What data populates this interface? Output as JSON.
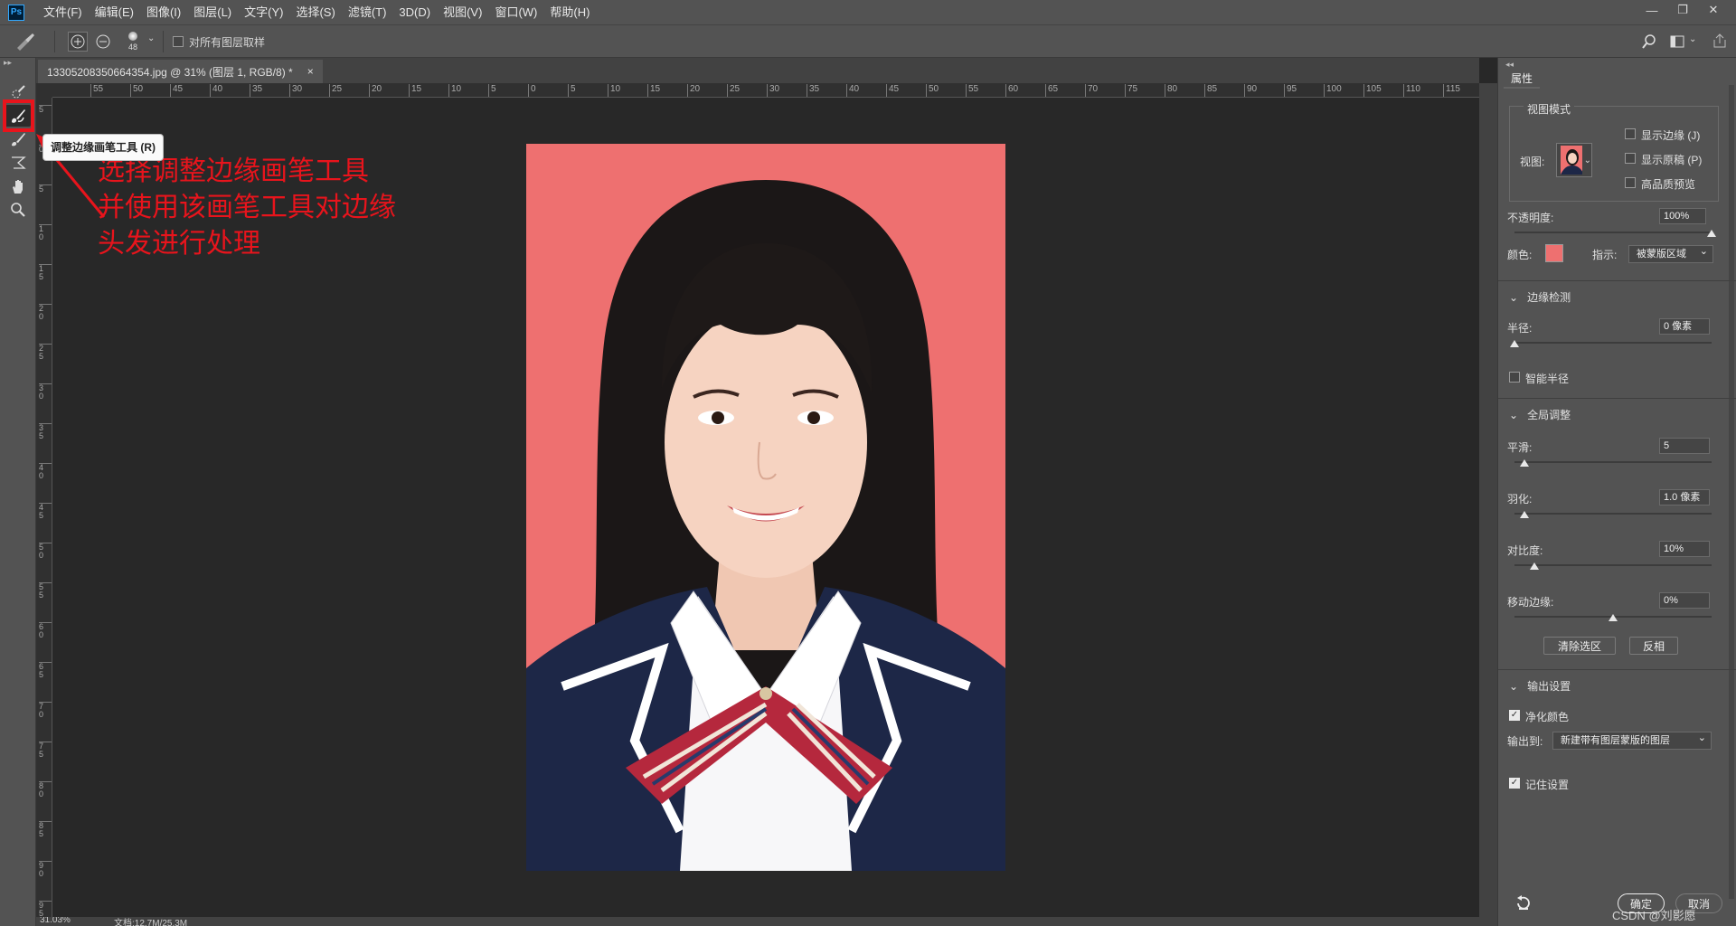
{
  "app": {
    "logo": "Ps"
  },
  "menu": [
    "文件(F)",
    "编辑(E)",
    "图像(I)",
    "图层(L)",
    "文字(Y)",
    "选择(S)",
    "滤镜(T)",
    "3D(D)",
    "视图(V)",
    "窗口(W)",
    "帮助(H)"
  ],
  "options": {
    "brush_size": "48",
    "sample_all_layers": "对所有图层取样"
  },
  "document": {
    "tab_title": "13305208350664354.jpg @ 31% (图层 1, RGB/8) *",
    "close": "×"
  },
  "ruler": {
    "h_ticks": [
      "55",
      "50",
      "45",
      "40",
      "35",
      "30",
      "25",
      "20",
      "15",
      "10",
      "5",
      "0",
      "5",
      "10",
      "15",
      "20",
      "25",
      "30",
      "35",
      "40",
      "45",
      "50",
      "55",
      "60",
      "65",
      "70",
      "75",
      "80",
      "85",
      "90",
      "95",
      "100",
      "105",
      "110",
      "115"
    ],
    "v_ticks": [
      "5",
      "0",
      "5",
      "1\n0",
      "1\n5",
      "2\n0",
      "2\n5",
      "3\n0",
      "3\n5",
      "4\n0",
      "4\n5",
      "5\n0",
      "5\n5",
      "6\n0",
      "6\n5",
      "7\n0",
      "7\n5",
      "8\n0",
      "8\n5",
      "9\n0",
      "9\n5"
    ]
  },
  "tooltip": {
    "text": "调整边缘画笔工具 (R)"
  },
  "annotation": {
    "lines": [
      "选择调整边缘画笔工具",
      "并使用该画笔工具对边缘",
      "头发进行处理"
    ],
    "color": "#e8141c"
  },
  "status": {
    "zoom": "31.03%",
    "doc": "文档:12.7M/25.3M"
  },
  "panel": {
    "tab": "属性",
    "view_mode": {
      "title": "视图模式",
      "view_label": "视图:",
      "show_edge": "显示边缘 (J)",
      "show_original": "显示原稿 (P)",
      "hq_preview": "高品质预览"
    },
    "opacity": {
      "label": "不透明度:",
      "value": "100%",
      "level": 1.0
    },
    "color": {
      "label": "颜色:",
      "swatch": "#ee7070",
      "indicate_label": "指示:",
      "indicate_value": "被蒙版区域"
    },
    "edge_detection": {
      "title": "边缘检测",
      "radius_label": "半径:",
      "radius_value": "0 像素",
      "radius_level": 0.0,
      "smart_radius": "智能半径"
    },
    "global": {
      "title": "全局调整",
      "smooth_label": "平滑:",
      "smooth_value": "5",
      "smooth_level": 0.05,
      "feather_label": "羽化:",
      "feather_value": "1.0 像素",
      "feather_level": 0.05,
      "contrast_label": "对比度:",
      "contrast_value": "10%",
      "contrast_level": 0.1,
      "shift_label": "移动边缘:",
      "shift_value": "0%",
      "shift_level": 0.5,
      "clear_btn": "清除选区",
      "invert_btn": "反相"
    },
    "output": {
      "title": "输出设置",
      "decontaminate": "净化颜色",
      "output_to_label": "输出到:",
      "output_to_value": "新建带有图层蒙版的图层",
      "remember": "记住设置"
    },
    "footer": {
      "ok": "确定",
      "cancel": "取消",
      "watermark": "CSDN @刘影愿"
    }
  },
  "colors": {
    "bg_red": "#ee7070",
    "suit": "#1d2747"
  }
}
